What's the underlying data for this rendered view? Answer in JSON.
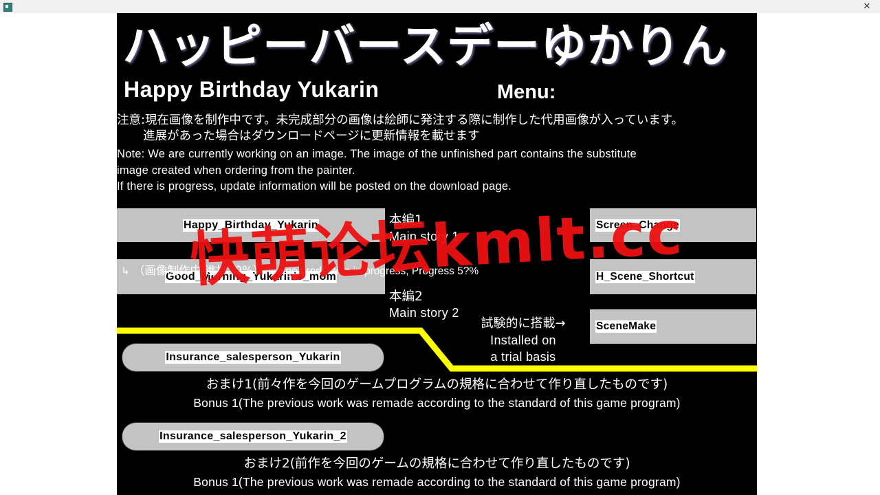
{
  "window": {
    "app_icon": "app-icon",
    "close_label": "✕"
  },
  "game": {
    "title_jp": "ハッピーバースデーゆかりん",
    "title_en": "Happy Birthday Yukarin",
    "menu_label": "Menu:",
    "notice_jp_line1": "注意:現在画像を制作中です。未完成部分の画像は絵師に発注する際に制作した代用画像が入っています。",
    "notice_jp_line2": "進展があった場合はダウンロードページに更新情報を載せます",
    "notice_en_line1": "Note: We are currently working on an image. The image of the unfinished part contains the substitute",
    "notice_en_line2": "image created when ordering from the painter.",
    "notice_en_line3": "If there is progress, update information will be posted on the download page."
  },
  "buttons": {
    "happy_birthday": "Happy_Birthday_Yukarin",
    "good_morning": "Good_Morning_Yukarin's_mom",
    "screen_change": "Screen_Change",
    "h_scene_shortcut": "H_Scene_Shortcut",
    "scenemake": "SceneMake",
    "bonus_1": "Insurance_salesperson_Yukarin",
    "bonus_2": "Insurance_salesperson_Yukarin_2"
  },
  "chapters": [
    {
      "jp": "本編1",
      "en": "Main story 1"
    },
    {
      "jp": "本編2",
      "en": "Main story 2"
    }
  ],
  "progress_note": {
    "arrow": "↳",
    "jp": "（画像制作中 進捗70%）",
    "en": "Image production in progress, Progress 5?%"
  },
  "trial_note": {
    "jp": "試験的に搭載→",
    "en_line1": "Installed on",
    "en_line2": "a trial basis"
  },
  "bonus": [
    {
      "jp": "おまけ1(前々作を今回のゲームプログラムの規格に合わせて作り直したものです)",
      "en": "Bonus 1(The previous work was remade according to the standard of this game program)"
    },
    {
      "jp": "おまけ2(前作を今回のゲームの規格に合わせて作り直したものです)",
      "en": "Bonus 1(The previous work was remade according to the standard of this game program)"
    }
  ],
  "watermark": {
    "text": "快萌论坛kmlt.cc",
    "color": "#ee1111"
  },
  "colors": {
    "background": "#000000",
    "button_face": "#c3c3c3",
    "divider": "#ffff00",
    "text": "#ffffff"
  }
}
